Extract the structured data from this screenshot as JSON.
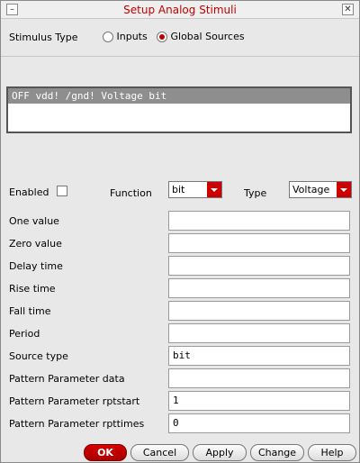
{
  "window": {
    "title": "Setup Analog Stimuli"
  },
  "stimulus_type": {
    "label": "Stimulus Type",
    "options": [
      {
        "label": "Inputs",
        "selected": false
      },
      {
        "label": "Global Sources",
        "selected": true
      }
    ]
  },
  "stimuli_list": {
    "rows": [
      "OFF  vdd! /gnd! Voltage bit"
    ]
  },
  "controls": {
    "enabled_label": "Enabled",
    "enabled_checked": false,
    "function_label": "Function",
    "function_value": "bit",
    "type_label": "Type",
    "type_value": "Voltage"
  },
  "fields": [
    {
      "label": "One value",
      "value": ""
    },
    {
      "label": "Zero value",
      "value": ""
    },
    {
      "label": "Delay time",
      "value": ""
    },
    {
      "label": "Rise time",
      "value": ""
    },
    {
      "label": "Fall time",
      "value": ""
    },
    {
      "label": "Period",
      "value": ""
    },
    {
      "label": "Source type",
      "value": "bit"
    },
    {
      "label": "Pattern Parameter data",
      "value": ""
    },
    {
      "label": "Pattern Parameter rptstart",
      "value": "1"
    },
    {
      "label": "Pattern Parameter rpttimes",
      "value": "0"
    }
  ],
  "buttons": {
    "ok": "OK",
    "cancel": "Cancel",
    "apply": "Apply",
    "change": "Change",
    "help": "Help"
  },
  "colors": {
    "accent": "#cc0000",
    "selection": "#8e8e8e"
  }
}
